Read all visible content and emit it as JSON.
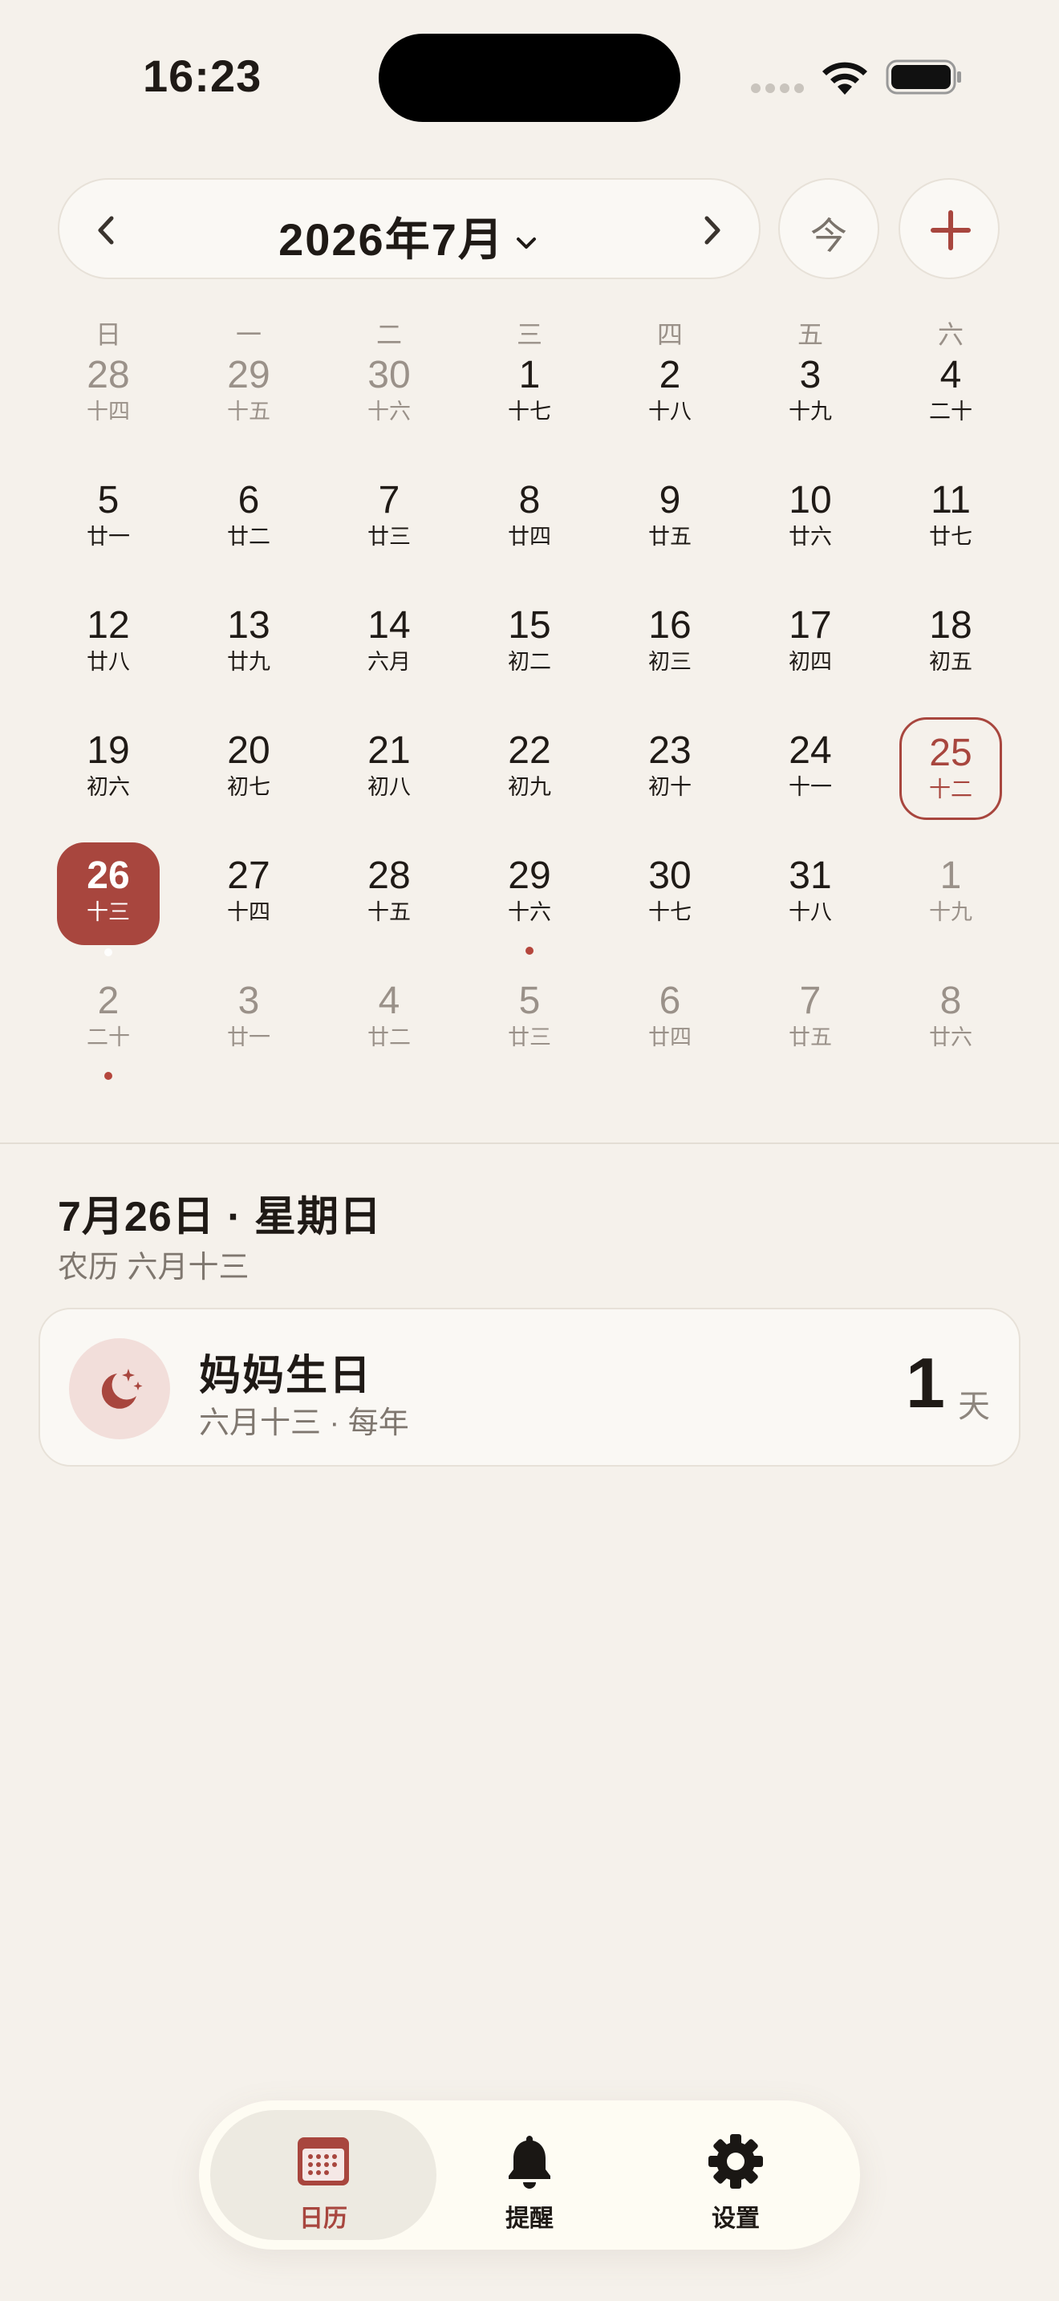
{
  "status_bar": {
    "time": "16:23"
  },
  "header": {
    "month_title": "2026年7月",
    "today_label": "今",
    "prev_icon": "chevron-left-icon",
    "next_icon": "chevron-right-icon",
    "add_icon": "plus-icon"
  },
  "weekdays": [
    "日",
    "一",
    "二",
    "三",
    "四",
    "五",
    "六"
  ],
  "calendar": {
    "weeks": [
      [
        {
          "num": "28",
          "lunar": "十四",
          "muted": true
        },
        {
          "num": "29",
          "lunar": "十五",
          "muted": true
        },
        {
          "num": "30",
          "lunar": "十六",
          "muted": true
        },
        {
          "num": "1",
          "lunar": "十七"
        },
        {
          "num": "2",
          "lunar": "十八"
        },
        {
          "num": "3",
          "lunar": "十九"
        },
        {
          "num": "4",
          "lunar": "二十"
        }
      ],
      [
        {
          "num": "5",
          "lunar": "廿一"
        },
        {
          "num": "6",
          "lunar": "廿二"
        },
        {
          "num": "7",
          "lunar": "廿三"
        },
        {
          "num": "8",
          "lunar": "廿四"
        },
        {
          "num": "9",
          "lunar": "廿五"
        },
        {
          "num": "10",
          "lunar": "廿六"
        },
        {
          "num": "11",
          "lunar": "廿七"
        }
      ],
      [
        {
          "num": "12",
          "lunar": "廿八"
        },
        {
          "num": "13",
          "lunar": "廿九"
        },
        {
          "num": "14",
          "lunar": "六月"
        },
        {
          "num": "15",
          "lunar": "初二"
        },
        {
          "num": "16",
          "lunar": "初三"
        },
        {
          "num": "17",
          "lunar": "初四"
        },
        {
          "num": "18",
          "lunar": "初五"
        }
      ],
      [
        {
          "num": "19",
          "lunar": "初六"
        },
        {
          "num": "20",
          "lunar": "初七"
        },
        {
          "num": "21",
          "lunar": "初八"
        },
        {
          "num": "22",
          "lunar": "初九"
        },
        {
          "num": "23",
          "lunar": "初十"
        },
        {
          "num": "24",
          "lunar": "十一"
        },
        {
          "num": "25",
          "lunar": "十二",
          "today": true
        }
      ],
      [
        {
          "num": "26",
          "lunar": "十三",
          "selected": true,
          "event": true
        },
        {
          "num": "27",
          "lunar": "十四"
        },
        {
          "num": "28",
          "lunar": "十五"
        },
        {
          "num": "29",
          "lunar": "十六",
          "event": true
        },
        {
          "num": "30",
          "lunar": "十七"
        },
        {
          "num": "31",
          "lunar": "十八"
        },
        {
          "num": "1",
          "lunar": "十九",
          "muted": true
        }
      ],
      [
        {
          "num": "2",
          "lunar": "二十",
          "muted": true,
          "event": true
        },
        {
          "num": "3",
          "lunar": "廿一",
          "muted": true
        },
        {
          "num": "4",
          "lunar": "廿二",
          "muted": true
        },
        {
          "num": "5",
          "lunar": "廿三",
          "muted": true
        },
        {
          "num": "6",
          "lunar": "廿四",
          "muted": true
        },
        {
          "num": "7",
          "lunar": "廿五",
          "muted": true
        },
        {
          "num": "8",
          "lunar": "廿六",
          "muted": true
        }
      ]
    ]
  },
  "detail": {
    "date": "7月26日 · 星期日",
    "lunar": "农历 六月十三"
  },
  "event": {
    "icon": "moon-stars-icon",
    "title": "妈妈生日",
    "subtitle": "六月十三 · 每年",
    "count": "1",
    "unit": "天"
  },
  "tab_bar": {
    "tabs": [
      {
        "label": "日历",
        "icon": "calendar-icon",
        "active": true
      },
      {
        "label": "提醒",
        "icon": "bell-icon"
      },
      {
        "label": "设置",
        "icon": "gear-icon"
      }
    ]
  },
  "colors": {
    "accent": "#A8463E",
    "background": "#F5F1EB",
    "card": "#FAF8F4",
    "muted_text": "#9A9189"
  }
}
